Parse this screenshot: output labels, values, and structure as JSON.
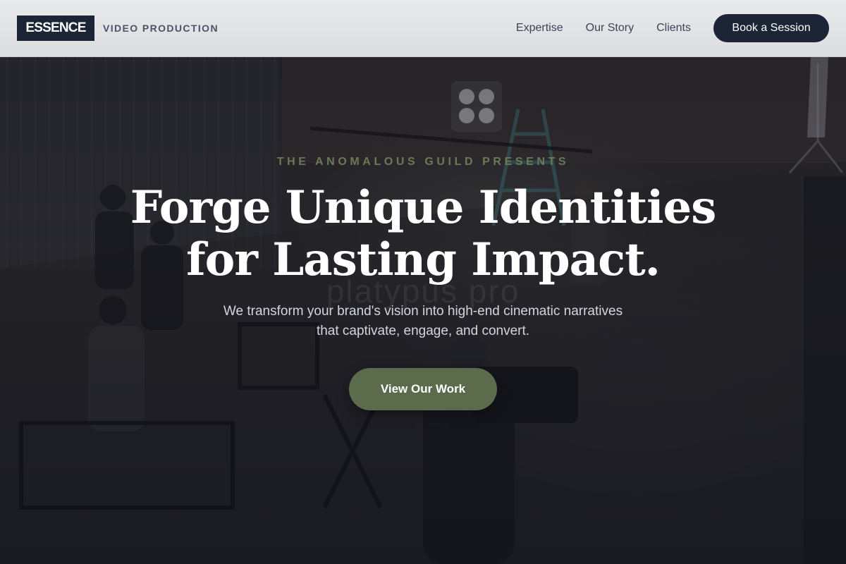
{
  "header": {
    "logo_text": "ESSENCE",
    "tagline": "VIDEO PRODUCTION",
    "nav": [
      {
        "label": "Expertise"
      },
      {
        "label": "Our Story"
      },
      {
        "label": "Clients"
      }
    ],
    "cta_label": "Book a Session"
  },
  "hero": {
    "eyebrow": "THE ANOMALOUS GUILD PRESENTS",
    "headline_line1": "Forge Unique Identities",
    "headline_line2": "for Lasting Impact.",
    "ghost_text": "platypus pro",
    "subhead_line1": "We transform your brand's vision into high-end cinematic narratives",
    "subhead_line2": "that captivate, engage, and convert.",
    "cta_label": "View Our Work",
    "background_image": "film-production-set-photo"
  },
  "colors": {
    "navy": "#1c2536",
    "olive_accent": "#5c6b4b",
    "eyebrow_green": "#6a7a56",
    "nav_text": "#3a4556",
    "navbar_bg": "#e2e3e6"
  }
}
